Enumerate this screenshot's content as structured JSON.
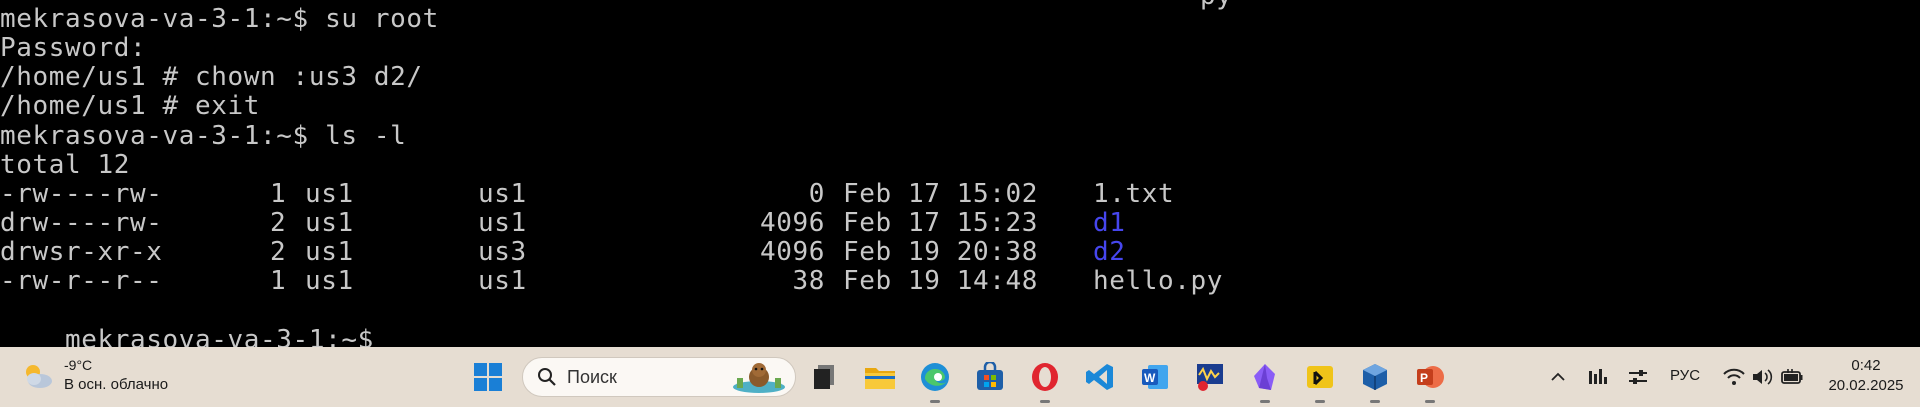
{
  "terminal": {
    "partial_top": "py",
    "lines": [
      "mekrasova-va-3-1:~$ su root",
      "Password:",
      "/home/us1 # chown :us3 d2/",
      "/home/us1 # exit",
      "mekrasova-va-3-1:~$ ls -l",
      "total 12"
    ],
    "listing": [
      {
        "perm": "-rw----rw-",
        "links": "1",
        "owner": "us1",
        "group": "us1",
        "size": "0",
        "date": "Feb 17 15:02",
        "name": "1.txt",
        "is_dir": false
      },
      {
        "perm": "drw----rw-",
        "links": "2",
        "owner": "us1",
        "group": "us1",
        "size": "4096",
        "date": "Feb 17 15:23",
        "name": "d1",
        "is_dir": true
      },
      {
        "perm": "drwsr-xr-x",
        "links": "2",
        "owner": "us1",
        "group": "us3",
        "size": "4096",
        "date": "Feb 19 20:38",
        "name": "d2",
        "is_dir": true
      },
      {
        "perm": "-rw-r--r--",
        "links": "1",
        "owner": "us1",
        "group": "us1",
        "size": "38",
        "date": "Feb 19 14:48",
        "name": "hello.py",
        "is_dir": false
      }
    ],
    "prompt": "mekrasova-va-3-1:~$",
    "colors": {
      "text": "#c8c8c8",
      "directory": "#4646ee",
      "background": "#000000"
    }
  },
  "taskbar": {
    "weather": {
      "temp": "-9°C",
      "condition": "В осн. облачно",
      "icon": "partly-cloudy-icon"
    },
    "search": {
      "label": "Поиск"
    },
    "apps": [
      {
        "name": "windows-start",
        "icon": "windows-logo-icon"
      },
      {
        "name": "task-view",
        "icon": "task-view-icon"
      },
      {
        "name": "file-explorer",
        "icon": "folder-icon"
      },
      {
        "name": "edge",
        "icon": "edge-icon"
      },
      {
        "name": "store",
        "icon": "store-icon"
      },
      {
        "name": "opera",
        "icon": "opera-icon"
      },
      {
        "name": "vscode",
        "icon": "vscode-icon"
      },
      {
        "name": "word",
        "icon": "word-icon"
      },
      {
        "name": "oscilloscope",
        "icon": "scope-icon"
      },
      {
        "name": "obsidian",
        "icon": "obsidian-icon"
      },
      {
        "name": "putty",
        "icon": "terminal-app-icon"
      },
      {
        "name": "virtualbox",
        "icon": "virtualbox-icon"
      },
      {
        "name": "powerpoint",
        "icon": "powerpoint-icon"
      }
    ],
    "tray": {
      "language": "РУС",
      "time": "0:42",
      "date": "20.02.2025"
    },
    "colors": {
      "background": "#e6ddd2"
    }
  }
}
